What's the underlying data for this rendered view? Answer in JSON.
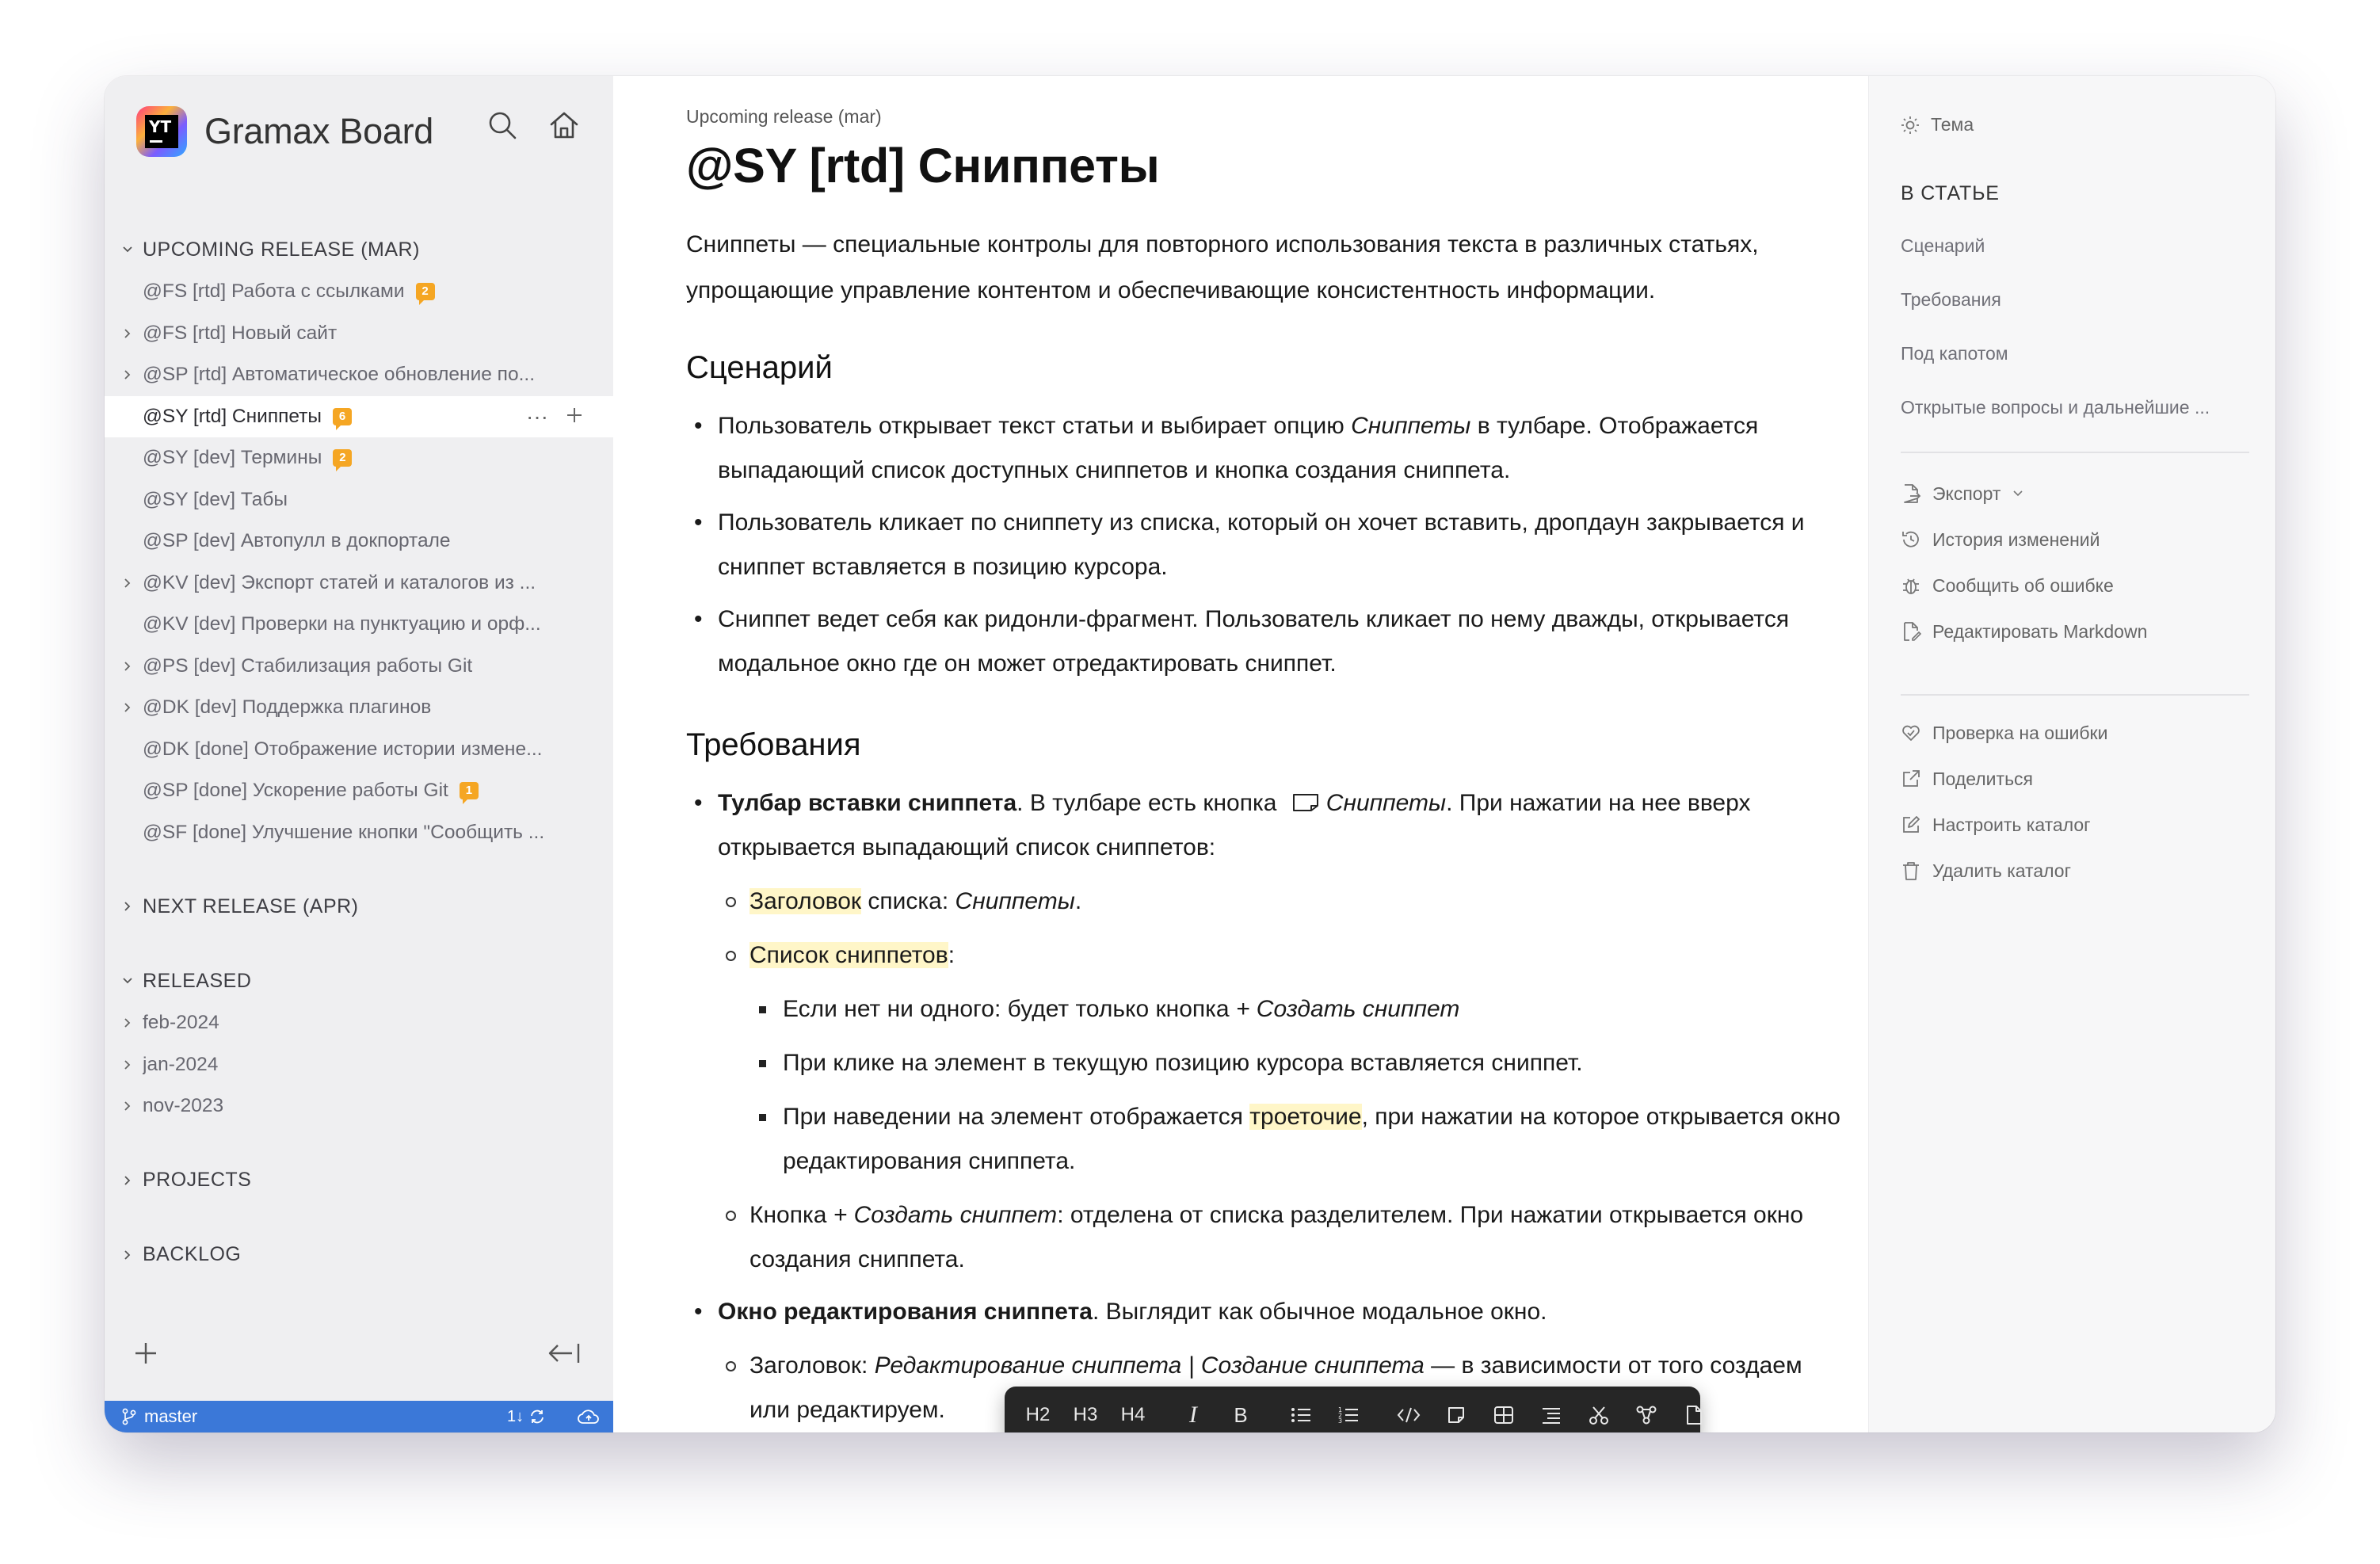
{
  "app": {
    "logo_text": "YT",
    "name": "Gramax Board"
  },
  "sidebar": {
    "sections": [
      {
        "title": "UPCOMING RELEASE (MAR)",
        "items": [
          {
            "label": "@FS [rtd] Работа с ссылками",
            "badge": "2"
          },
          {
            "label": "@FS [rtd] Новый сайт"
          },
          {
            "label": "@SP [rtd] Автоматическое обновление по..."
          },
          {
            "label": "@SY [rtd] Сниппеты",
            "badge": "6"
          },
          {
            "label": "@SY [dev] Термины",
            "badge": "2"
          },
          {
            "label": "@SY [dev] Табы"
          },
          {
            "label": "@SP [dev] Автопулл в докпортале"
          },
          {
            "label": "@KV [dev] Экспорт статей и каталогов из ..."
          },
          {
            "label": "@KV [dev] Проверки на пунктуацию и орф..."
          },
          {
            "label": "@PS [dev] Стабилизация работы Git"
          },
          {
            "label": "@DK [dev] Поддержка плагинов"
          },
          {
            "label": "@DK [done] Отображение истории измене..."
          },
          {
            "label": "@SP [done] Ускорение работы Git",
            "badge": "1"
          },
          {
            "label": "@SF [done] Улучшение кнопки \"Сообщить ..."
          }
        ]
      },
      {
        "title": "NEXT RELEASE (APR)"
      },
      {
        "title": "RELEASED",
        "items": [
          {
            "label": "feb-2024"
          },
          {
            "label": "jan-2024"
          },
          {
            "label": "nov-2023"
          }
        ]
      },
      {
        "title": "PROJECTS"
      },
      {
        "title": "BACKLOG"
      }
    ]
  },
  "status": {
    "branch": "master",
    "sync": "1↓"
  },
  "article": {
    "breadcrumb": "Upcoming release (mar)",
    "title": "@SY [rtd] Сниппеты",
    "intro": "Сниппеты — специальные контролы для повторного использования текста в различных статьях, упрощающие управление контентом и обеспечивающие консистентность информации.",
    "h_scenario": "Сценарий",
    "scenario": [
      {
        "pre": "Пользователь открывает текст статьи и выбирает опцию ",
        "em": "Сниппеты",
        "post": " в тулбаре. Отображается выпадающий список доступных сниппетов и кнопка создания сниппета."
      },
      {
        "text": "Пользователь кликает по сниппету из списка, который он хочет вставить, дропдаун закрывается и сниппет вставляется в позицию курсора."
      },
      {
        "text": "Сниппет ведет себя как ридонли-фрагмент. Пользователь кликает по нему дважды, открывается модальное окно где он может отредактировать сниппет."
      }
    ],
    "h_requirements": "Требования",
    "req1": {
      "bold": "Тулбар вставки сниппета",
      "mid": ". В тулбаре есть кнопка ",
      "em": "Сниппеты",
      "post": ". При нажатии на нее вверх открывается выпадающий список сниппетов:",
      "sub1_hl": "Заголовок",
      "sub1_rest": " списка: ",
      "sub1_em": "Сниппеты",
      "sub1_end": ".",
      "sub2_hl": "Список сниппетов",
      "sub2_end": ":",
      "sub2_items": [
        {
          "pre": "Если нет ни одного: будет только кнопка ",
          "em": "+ Создать сниппет"
        },
        {
          "pre": "При клике на элемент в текущую позицию курсора вставляется сниппет."
        },
        {
          "pre": "При наведении на элемент отображается ",
          "hl": "троеточие",
          "post": ", при нажатии на которое открывается окно редактирования сниппета."
        }
      ],
      "sub3_pre": "Кнопка ",
      "sub3_em": "+ Создать сниппет",
      "sub3_post": ": отделена от списка разделителем. При нажатии открывается окно создания сниппета."
    },
    "req2": {
      "bold": "Окно редактирования сниппета",
      "post": ". Выглядит как обычное модальное окно.",
      "sub_pre": "Заголовок: ",
      "sub_em": "Редактирование сниппета | Создание сниппета",
      "sub_post": " — в зависимости от того создаем или редактируем."
    }
  },
  "toolbar": {
    "h2": "H2",
    "h3": "H3",
    "h4": "H4",
    "italic": "I",
    "bold": "B"
  },
  "right_panel": {
    "theme": "Тема",
    "toc_title": "В СТАТЬЕ",
    "toc": [
      "Сценарий",
      "Требования",
      "Под капотом",
      "Открытые вопросы и дальнейшие ..."
    ],
    "actions1": [
      "Экспорт",
      "История изменений",
      "Сообщить об ошибке",
      "Редактировать Markdown"
    ],
    "actions2": [
      "Проверка на ошибки",
      "Поделиться",
      "Настроить каталог",
      "Удалить каталог"
    ]
  },
  "colors": {
    "sidebar_bg": "#efeff1",
    "status_bar": "#3b78d8",
    "badge": "#f5a623",
    "highlight": "#fff6c8",
    "toolbar_bg": "#262626"
  }
}
